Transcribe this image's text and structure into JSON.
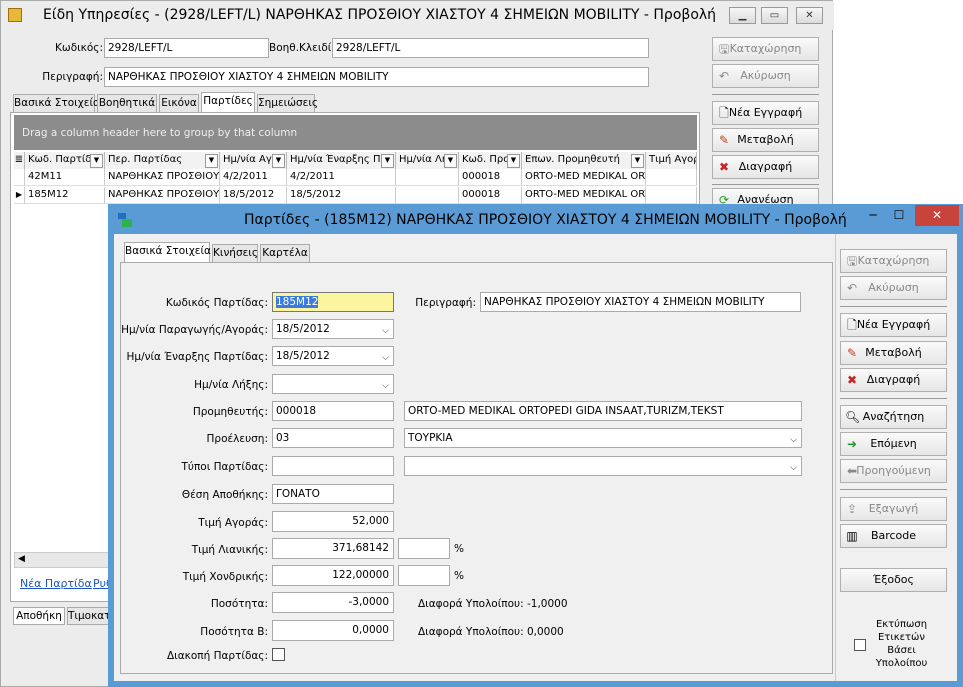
{
  "back": {
    "title": "Είδη Υπηρεσίες - (2928/LEFT/L) ΝΑΡΘΗΚΑΣ ΠΡΟΣΘΙΟΥ ΧΙΑΣΤΟΥ 4 ΣΗΜΕΙΩΝ MOBILITY -  Προβολή",
    "code_label": "Κωδικός:",
    "code_value": "2928/LEFT/L",
    "key_label": "Βοηθ.Κλειδί:",
    "key_value": "2928/LEFT/L",
    "desc_label": "Περιγραφή:",
    "desc_value": "ΝΑΡΘΗΚΑΣ ΠΡΟΣΘΙΟΥ ΧΙΑΣΤΟΥ 4 ΣΗΜΕΙΩΝ MOBILITY",
    "tabs": [
      "Βασικά Στοιχεία",
      "Βοηθητικά",
      "Εικόνα",
      "Παρτίδες",
      "Σημειώσεις"
    ],
    "group_hint": "Drag a column header here to group by that column",
    "columns": [
      "Κωδ. Παρτίδ",
      "Περ. Παρτίδας",
      "Ημ/νία Αγ",
      "Ημ/νία Έναρξης Πα",
      "Ημ/νία Λή",
      "Κωδ. Προ",
      "Επων. Προμηθευτή",
      "Τιμή Αγορ"
    ],
    "rows": [
      [
        "42Μ11",
        "ΝΑΡΘΗΚΑΣ ΠΡΟΣΘΙΟΥ",
        "4/2/2011",
        "4/2/2011",
        "",
        "000018",
        "ORTO-MED MEDIKAL ORT",
        ""
      ],
      [
        "185Μ12",
        "ΝΑΡΘΗΚΑΣ ΠΡΟΣΘΙΟΥ",
        "18/5/2012",
        "18/5/2012",
        "",
        "000018",
        "ORTO-MED MEDIKAL ORT",
        ""
      ]
    ],
    "links": [
      "Νέα Παρτίδα",
      "Ρυθ"
    ],
    "bottom_tabs": [
      "Αποθήκη",
      "Τιμοκατ"
    ],
    "buttons": {
      "save": "Καταχώρηση",
      "cancel": "Ακύρωση",
      "new": "Νέα Εγγραφή",
      "edit": "Μεταβολή",
      "delete": "Διαγραφή",
      "refresh": "Ανανέωση"
    }
  },
  "front": {
    "title": "Παρτίδες - (185Μ12) ΝΑΡΘΗΚΑΣ ΠΡΟΣΘΙΟΥ ΧΙΑΣΤΟΥ 4 ΣΗΜΕΙΩΝ MOBILITY -  Προβολή",
    "tabs": [
      "Βασικά Στοιχεία",
      "Κινήσεις",
      "Καρτέλα"
    ],
    "fields": {
      "batch_code_label": "Κωδικός Παρτίδας:",
      "batch_code": "185Μ12",
      "desc_label": "Περιγραφή:",
      "desc": "ΝΑΡΘΗΚΑΣ ΠΡΟΣΘΙΟΥ ΧΙΑΣΤΟΥ 4 ΣΗΜΕΙΩΝ MOBILITY",
      "prod_date_label": "Ημ/νία Παραγωγής/Αγοράς:",
      "prod_date": "18/5/2012",
      "start_date_label": "Ημ/νία Έναρξης Παρτίδας:",
      "start_date": "18/5/2012",
      "expiry_label": "Ημ/νία Λήξης:",
      "expiry": "",
      "supplier_label": "Προμηθευτής:",
      "supplier_code": "000018",
      "supplier_name": "ORTO-MED MEDIKAL ORTOPEDI GIDA INSAAT,TURIZM,TEKST",
      "origin_label": "Προέλευση:",
      "origin_code": "03",
      "origin_name": "ΤΟΥΡΚΙΑ",
      "types_label": "Τύποι Παρτίδας:",
      "types_code": "",
      "types_name": "",
      "location_label": "Θέση Αποθήκης:",
      "location": "ΓΟΝΑΤΟ",
      "buy_price_label": "Τιμή Αγοράς:",
      "buy_price": "52,000",
      "retail_label": "Τιμή Λιανικής:",
      "retail": "371,68142",
      "wholesale_label": "Τιμή Χονδρικής:",
      "wholesale": "122,00000",
      "pct": "%",
      "qty_label": "Ποσότητα:",
      "qty": "-3,0000",
      "qty_diff": "Διαφορά Υπολοίπου: -1,0000",
      "qtyb_label": "Ποσότητα Β:",
      "qtyb": "0,0000",
      "qtyb_diff": "Διαφορά Υπολοίπου: 0,0000",
      "stop_label": "Διακοπή Παρτίδας:"
    },
    "buttons": {
      "save": "Καταχώρηση",
      "cancel": "Ακύρωση",
      "new": "Νέα Εγγραφή",
      "edit": "Μεταβολή",
      "delete": "Διαγραφή",
      "search": "Αναζήτηση",
      "next": "Επόμενη",
      "prev": "Προηγούμενη",
      "export": "Εξαγωγή",
      "barcode": "Barcode",
      "exit": "Έξοδος"
    },
    "print_labels": "Εκτύπωση Ετικετών Βάσει Υπολοίπου"
  }
}
